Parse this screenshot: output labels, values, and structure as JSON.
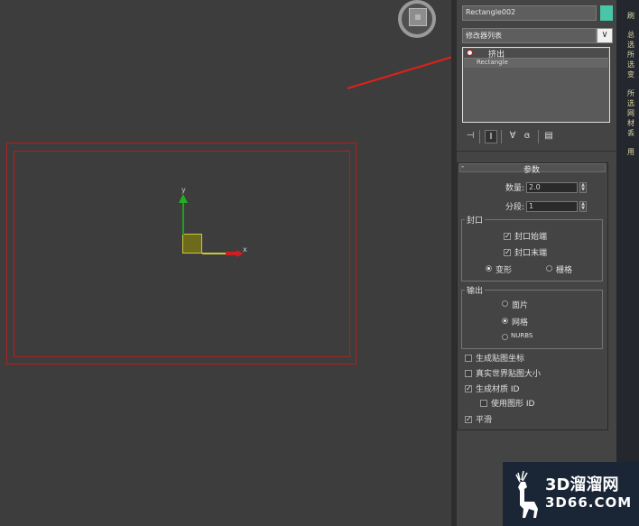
{
  "viewport": {
    "axis_y": "y",
    "axis_x": "x"
  },
  "panel": {
    "object_name": "Rectangle002",
    "object_color": "#49c6a8",
    "modifier_list": "修改器列表",
    "modifier_list_arrow": "∨",
    "stack": [
      {
        "label": "挤出",
        "active": true
      },
      {
        "label": "Rectangle",
        "active": false
      }
    ],
    "toolbar_icons": [
      "pin-stack-icon",
      "show-end-result-icon",
      "make-unique-icon",
      "remove-modifier-icon",
      "configure-sets-icon"
    ],
    "rollout": {
      "collapse": "-",
      "title": "参数",
      "amount_label": "数量:",
      "amount_value": "2.0",
      "segments_label": "分段:",
      "segments_value": "1",
      "capping": {
        "title": "封口",
        "cap_start": "封口始端",
        "cap_start_checked": true,
        "cap_end": "封口末端",
        "cap_end_checked": true,
        "morph": "变形",
        "grid": "栅格",
        "selected": "morph"
      },
      "output": {
        "title": "输出",
        "patch": "面片",
        "mesh": "网格",
        "nurbs": "NURBS",
        "selected": "mesh"
      },
      "gen_mapping": "生成贴图坐标",
      "gen_mapping_checked": false,
      "real_world": "真实世界贴图大小",
      "real_world_checked": false,
      "gen_mat_ids": "生成材质 ID",
      "gen_mat_ids_checked": true,
      "use_shape_ids": "使用图形 ID",
      "use_shape_ids_checked": false,
      "smooth": "平滑",
      "smooth_checked": true
    }
  },
  "help": {
    "lines": [
      "刷",
      "总",
      "选",
      "所",
      "选",
      "变",
      "所",
      "选",
      "网",
      "材",
      "丢",
      "用"
    ]
  },
  "watermark": {
    "cn": "3D溜溜网",
    "en": "3D66.COM"
  },
  "colors": {
    "annotation_arrow": "#e0201a",
    "rectangle_outline": "#b02020",
    "y_axis": "#22b022",
    "x_axis": "#cc1f1f"
  }
}
